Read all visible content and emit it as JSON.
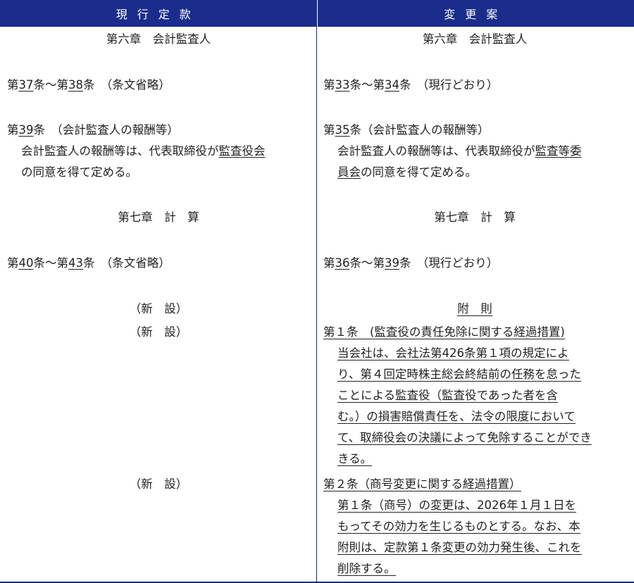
{
  "header": {
    "left": "現行定款",
    "right": "変更案"
  },
  "left": {
    "chapter6": "第六章　会計監査人",
    "art37_prefix": "第",
    "art37_num1": "37",
    "art37_mid": "条～第",
    "art37_num2": "38",
    "art37_suffix": "条　（条文省略）",
    "art39_prefix": "第",
    "art39_num": "39",
    "art39_title": "条　（会計監査人の報酬等）",
    "art39_body1a": "会計監査人の報酬等は、代表取締役が",
    "art39_body1b": "監査役会",
    "art39_body2": "の同意を得て定める。",
    "chapter7": "第七章　計　算",
    "art40_prefix": "第",
    "art40_num1": "40",
    "art40_mid": "条～第",
    "art40_num2": "43",
    "art40_suffix": "条　（条文省略）",
    "new1": "（新　設）",
    "new2": "（新　設）",
    "new3": "（新　設）"
  },
  "right": {
    "chapter6": "第六章　会計監査人",
    "art33_prefix": "第",
    "art33_num1": "33",
    "art33_mid": "条～第",
    "art33_num2": "34",
    "art33_suffix": "条　（現行どおり）",
    "art35_prefix": "第",
    "art35_num": "35",
    "art35_title": "条（会計監査人の報酬等）",
    "art35_body1a": "会計監査人の報酬等は、代表取締役が",
    "art35_body1b": "監査等委",
    "art35_body2a": "員会",
    "art35_body2b": "の同意を得て定める。",
    "chapter7": "第七章　計　算",
    "art36_prefix": "第",
    "art36_num1": "36",
    "art36_mid": "条～第",
    "art36_num2": "39",
    "art36_suffix": "条　（現行どおり）",
    "supp_title": "附　則",
    "supp1_title": "第１条　(監査役の責任免除に関する経過措置)",
    "supp1_lines": [
      "当会社は、会社法第426条第１項の規定によ",
      "り、第４回定時株主総会終結前の任務を怠った",
      "ことによる監査役（監査役であった者を含",
      "む。）の損害賠償責任を、法令の限度において",
      "て、取締役会の決議によって免除することができ",
      "きる。"
    ],
    "supp2_title": "第２条（商号変更に関する経過措置）",
    "supp2_lines": [
      "第１条（商号）の変更は、2026年１月１日を",
      "もってその効力を生じるものとする。なお、本",
      "附則は、定款第１条変更の効力発生後、これを",
      "削除する。"
    ]
  }
}
